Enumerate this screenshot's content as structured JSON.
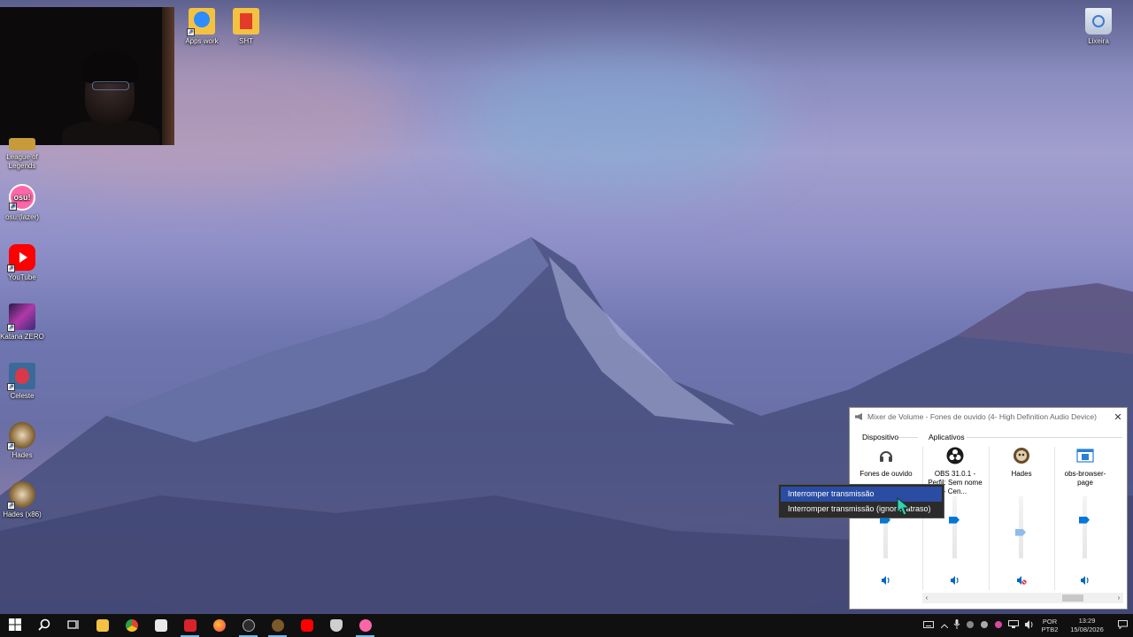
{
  "desktop": {
    "icons_top": [
      {
        "label": "Apps work",
        "icon": "zoom-folder-icon"
      },
      {
        "label": "SHT",
        "icon": "document-folder-icon"
      },
      {
        "label": "Lixeira",
        "icon": "recycle-bin-icon"
      }
    ],
    "icons_left": [
      {
        "label": "League of Legends",
        "icon": "league-of-legends-icon"
      },
      {
        "label": "osu!(lazer)",
        "icon": "osu-icon",
        "glyph": "osu!"
      },
      {
        "label": "YouTube",
        "icon": "youtube-icon"
      },
      {
        "label": "Katana ZERO",
        "icon": "katana-zero-icon"
      },
      {
        "label": "Celeste",
        "icon": "celeste-icon"
      },
      {
        "label": "Hades",
        "icon": "hades-icon"
      },
      {
        "label": "Hades (x86)",
        "icon": "hades-x86-icon"
      }
    ]
  },
  "mixer": {
    "title": "Mixer de Volume - Fones de ouvido (4- High Definition Audio Device)",
    "close_glyph": "✕",
    "device_group": "Dispositivo",
    "apps_group": "Aplicativos",
    "channels": [
      {
        "name": "Fones de ouvido",
        "icon": "headphones-icon",
        "level": 0.62,
        "muted": false
      },
      {
        "name": "OBS 31.0.1 - Perfil: Sem nome - Cen...",
        "icon": "obs-icon",
        "level": 0.62,
        "muted": false
      },
      {
        "name": "Hades",
        "icon": "hades-icon",
        "level": 0.42,
        "muted": true
      },
      {
        "name": "obs-browser-page",
        "icon": "browser-page-icon",
        "level": 0.62,
        "muted": false
      }
    ],
    "scroll_left": "‹",
    "scroll_right": "›"
  },
  "context_menu": {
    "items": [
      {
        "label": "Interromper transmissão",
        "highlighted": true
      },
      {
        "label": "Interromper transmissão (ignorar atraso)",
        "highlighted": false
      }
    ]
  },
  "taskbar": {
    "apps": [
      {
        "icon": "start-icon"
      },
      {
        "icon": "search-icon"
      },
      {
        "icon": "task-view-icon"
      },
      {
        "icon": "file-explorer-icon",
        "color": "#f3c242"
      },
      {
        "icon": "chrome-icon",
        "color": "#e34133"
      },
      {
        "icon": "store-icon",
        "color": "#e8e8e8"
      },
      {
        "icon": "red-app-icon",
        "color": "#d8232a"
      },
      {
        "icon": "firefox-icon",
        "color": "#ff7139"
      },
      {
        "icon": "obs-taskbar-icon",
        "color": "#2b2b2b"
      },
      {
        "icon": "hades-taskbar-icon",
        "color": "#7a5a2a"
      },
      {
        "icon": "youtube-taskbar-icon",
        "color": "#ff0000"
      },
      {
        "icon": "shield-app-icon",
        "color": "#cfcfcf"
      },
      {
        "icon": "osu-taskbar-icon",
        "color": "#ff66aa"
      }
    ],
    "lang": "POR",
    "layout": "PTB2",
    "time": "13:29",
    "date": "15/08/2026"
  },
  "colors": {
    "accent": "#0078d7",
    "menu_highlight": "#2a4ca3",
    "taskbar": "#101010"
  }
}
